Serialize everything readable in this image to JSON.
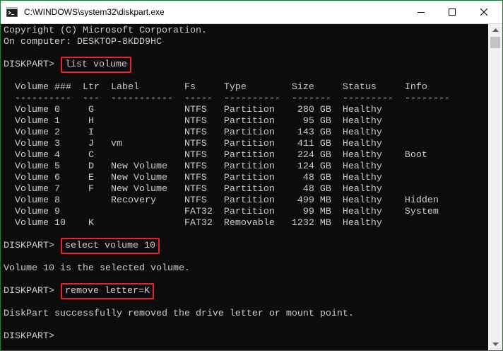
{
  "window": {
    "title": "C:\\WINDOWS\\system32\\diskpart.exe",
    "app_icon": "console-icon",
    "controls": {
      "minimize": "minimize-icon",
      "maximize": "maximize-icon",
      "close": "close-icon"
    }
  },
  "console": {
    "copyright": "Copyright (C) Microsoft Corporation.",
    "computer": "On computer: DESKTOP-8KDD9HC",
    "prompt": "DISKPART> ",
    "cmd1": "list volume",
    "table_header": "  Volume ###  Ltr  Label        Fs     Type        Size     Status     Info",
    "table_separator": "  ----------  ---  -----------  -----  ----------  -------  ---------  --------",
    "rows": [
      "  Volume 0     G                NTFS   Partition    280 GB  Healthy",
      "  Volume 1     H                NTFS   Partition     95 GB  Healthy",
      "  Volume 2     I                NTFS   Partition    143 GB  Healthy",
      "  Volume 3     J   vm           NTFS   Partition    411 GB  Healthy",
      "  Volume 4     C                NTFS   Partition    224 GB  Healthy    Boot",
      "  Volume 5     D   New Volume   NTFS   Partition    124 GB  Healthy",
      "  Volume 6     E   New Volume   NTFS   Partition     48 GB  Healthy",
      "  Volume 7     F   New Volume   NTFS   Partition     48 GB  Healthy",
      "  Volume 8         Recovery     NTFS   Partition    499 MB  Healthy    Hidden",
      "  Volume 9                      FAT32  Partition     99 MB  Healthy    System",
      "  Volume 10    K                FAT32  Removable   1232 MB  Healthy"
    ],
    "cmd2": "select volume 10",
    "result2": "Volume 10 is the selected volume.",
    "cmd3": "remove letter=K",
    "result3": "DiskPart successfully removed the drive letter or mount point.",
    "final_prompt": "DISKPART>"
  },
  "colors": {
    "console_bg": "#0c0c0c",
    "console_text": "#cccccc",
    "highlight_box": "#e8232a",
    "window_border": "#1f7a3a"
  }
}
